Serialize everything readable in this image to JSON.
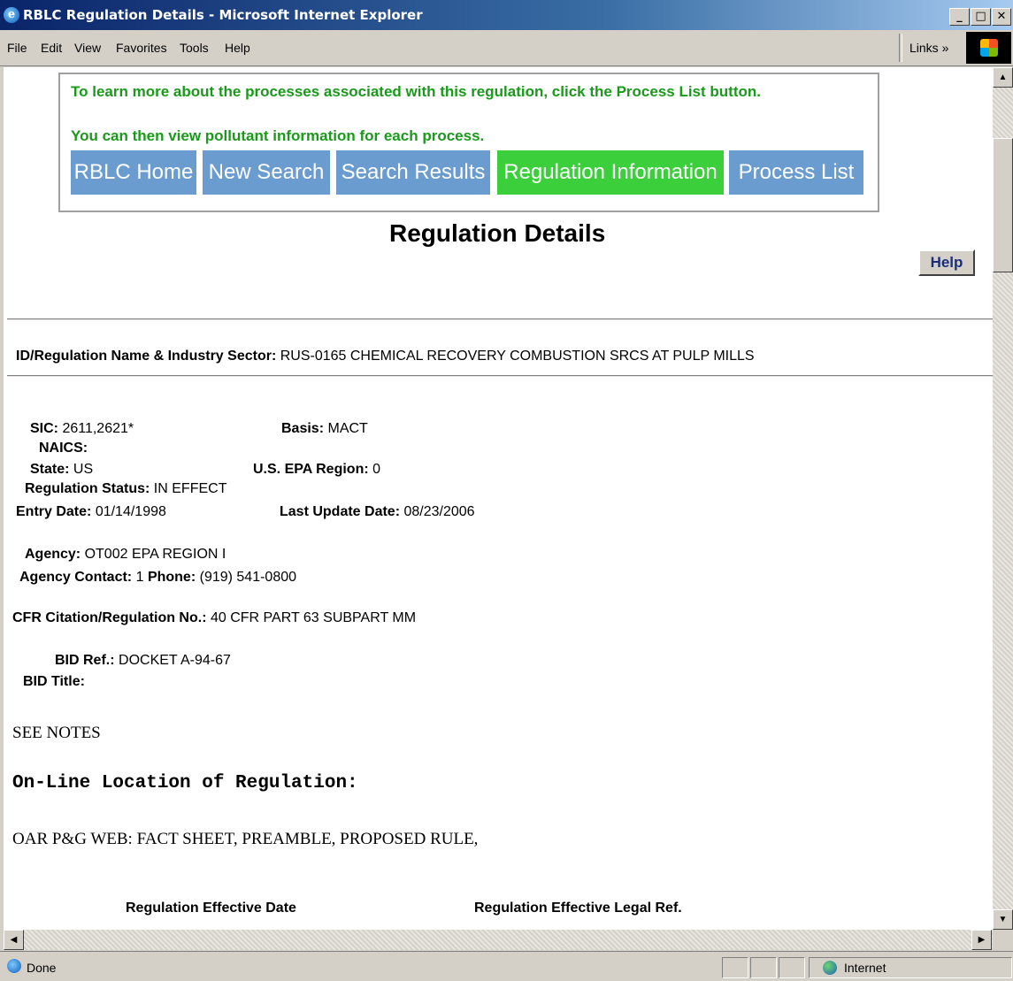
{
  "window": {
    "title": "RBLC Regulation Details - Microsoft Internet Explorer",
    "minimize": "_",
    "maximize": "□",
    "close": "✕"
  },
  "menu": {
    "items": [
      "File",
      "Edit",
      "View",
      "Favorites",
      "Tools",
      "Help"
    ],
    "links": "Links »"
  },
  "notice": {
    "line1": "To learn more about the processes associated with this regulation, click the Process List button.",
    "line2": "You can then view pollutant information for each process."
  },
  "nav": {
    "buttons": [
      "RBLC Home",
      "New Search",
      "Search Results",
      "Regulation Information",
      "Process List"
    ],
    "active": "Regulation Information",
    "colors": {
      "inactive": "#6a9cd0",
      "active": "#3ccf3c"
    }
  },
  "page": {
    "title": "Regulation Details",
    "help": "Help"
  },
  "regulation": {
    "id_label": "ID/Regulation Name & Industry Sector:",
    "id_value": "RUS-0165 CHEMICAL RECOVERY COMBUSTION SRCS AT PULP MILLS",
    "sic_label": "SIC:",
    "sic_value": "2611,2621*",
    "basis_label": "Basis:",
    "basis_value": "MACT",
    "naics_label": "NAICS:",
    "state_label": "State:",
    "state_value": "US",
    "epa_region_label": "U.S. EPA Region:",
    "epa_region_value": "0",
    "status_label": "Regulation Status:",
    "status_value": "IN EFFECT",
    "entry_date_label": "Entry Date:",
    "entry_date_value": "01/14/1998",
    "last_update_label": "Last Update Date:",
    "last_update_value": "08/23/2006",
    "agency_label": "Agency:",
    "agency_value": "OT002 EPA REGION I",
    "agency_contact_label": "Agency Contact:",
    "agency_contact_value": "1",
    "phone_label": "Phone:",
    "phone_value": "(919) 541-0800",
    "cfr_label": "CFR Citation/Regulation No.:",
    "cfr_value": "40 CFR PART 63 SUBPART MM",
    "bid_ref_label": "BID Ref.:",
    "bid_ref_value": "DOCKET A-94-67",
    "bid_title_label": "BID Title:",
    "notes": "SEE NOTES",
    "online_location_heading": "On-Line Location of Regulation:",
    "online_location_value": "OAR P&G WEB: FACT SHEET, PREAMBLE, PROPOSED RULE,",
    "effective_date_header": "Regulation Effective Date",
    "effective_legal_ref_header": "Regulation Effective Legal Ref."
  },
  "status_bar": {
    "status": "Done",
    "zone": "Internet"
  }
}
